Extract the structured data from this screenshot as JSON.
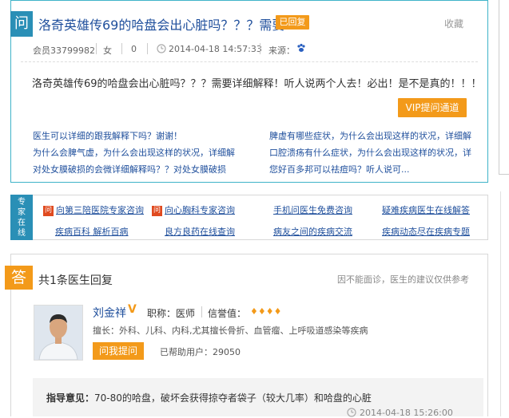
{
  "question": {
    "icon": "问",
    "title": "洛奇英雄传69的哈盘会出心脏吗？？？需要",
    "status_badge": "已回复",
    "collect": "收藏",
    "meta": {
      "member": "会员33799982",
      "gender": "女",
      "age": "0",
      "time": "2014-04-18 14:57:33",
      "source_label": "来源："
    },
    "body": "洛奇英雄传69的哈盘会出心脏吗？？？需要详细解释！听人说两个人去！必出！是不是真的！！！",
    "vip_button": "VIP提问通道",
    "related_left": [
      "医生可以详细的跟我解释下吗？谢谢！",
      "为什么会脾气虚，为什么会出现这样的状况，详细解",
      "对处女膜破损的会微详细解释吗？？对处女膜破损"
    ],
    "related_right": [
      "脾虚有哪些症状，为什么会出现这样的状况，详细解",
      "口腔溃疡有什么症状，为什么会出现这样的状况，详",
      "您好百多邦可以祛痘吗？听人说可..."
    ]
  },
  "expert": {
    "strip": [
      "专",
      "家",
      "在",
      "线"
    ],
    "row1": [
      "向第三陪医院专家咨询",
      "向心胸科专家咨询",
      "手机问医生免费咨询",
      "疑难疾病医生在线解答"
    ],
    "row2": [
      "疾病百科  解析百病",
      "良方良药在线查询",
      "病友之间的疾病交流",
      "疾病动态尽在疾病专题"
    ],
    "badge_char": "问"
  },
  "answers": {
    "icon": "答",
    "title": "共1条医生回复",
    "note": "因不能面诊，医生的建议仅供参考",
    "doctor": {
      "name": "刘金祥",
      "title": "职称：医师",
      "credit_label": "信誉值：",
      "specialty": "擅长：外科、儿科、内科,尤其擅长骨折、血管瘤、上呼吸道感染等疾病",
      "ask_button": "问我提问",
      "helped": "已帮助用户：29050"
    },
    "guide_label": "指导意见：",
    "guide_text": "70-80的哈盘，破坏会获得掠夺者袋子（较大几率）和哈盘的心脏",
    "guide_time": "2014-04-18 15:26:00"
  }
}
